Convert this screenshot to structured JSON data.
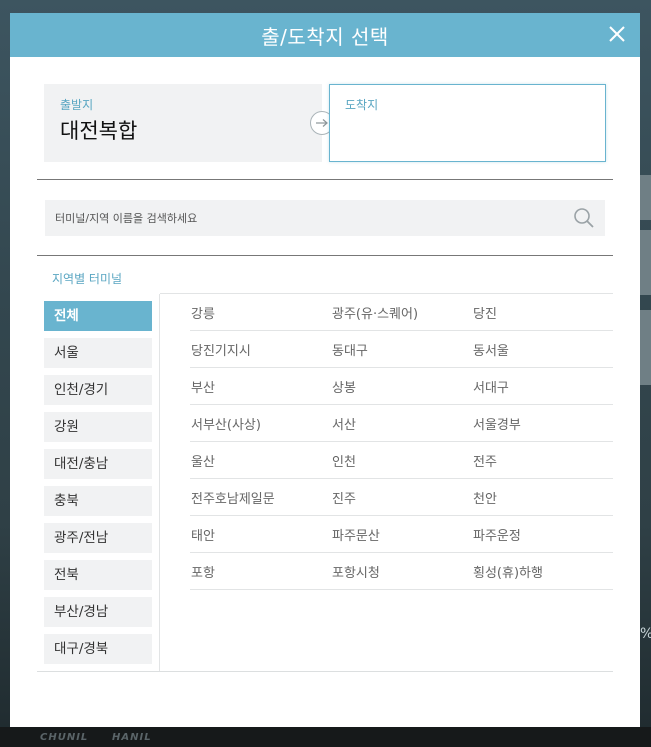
{
  "modal": {
    "title": "출/도착지 선택"
  },
  "route": {
    "departure_label": "출발지",
    "departure_value": "대전복합",
    "arrival_label": "도착지",
    "arrival_value": ""
  },
  "search": {
    "placeholder": "터미널/지역 이름을 검색하세요",
    "value": ""
  },
  "region_section": {
    "title": "지역별 터미널"
  },
  "regions": [
    {
      "label": "전체",
      "active": true
    },
    {
      "label": "서울",
      "active": false
    },
    {
      "label": "인천/경기",
      "active": false
    },
    {
      "label": "강원",
      "active": false
    },
    {
      "label": "대전/충남",
      "active": false
    },
    {
      "label": "충북",
      "active": false
    },
    {
      "label": "광주/전남",
      "active": false
    },
    {
      "label": "전북",
      "active": false
    },
    {
      "label": "부산/경남",
      "active": false
    },
    {
      "label": "대구/경북",
      "active": false
    }
  ],
  "terminals": [
    [
      "강릉",
      "광주(유·스퀘어)",
      "당진"
    ],
    [
      "당진기지시",
      "동대구",
      "동서울"
    ],
    [
      "부산",
      "상봉",
      "서대구"
    ],
    [
      "서부산(사상)",
      "서산",
      "서울경부"
    ],
    [
      "울산",
      "인천",
      "전주"
    ],
    [
      "전주호남제일문",
      "진주",
      "천안"
    ],
    [
      "태안",
      "파주문산",
      "파주운정"
    ],
    [
      "포항",
      "포항시청",
      "횡성(휴)하행"
    ]
  ],
  "background": {
    "footer_logo_1": "CHUNIL",
    "footer_logo_2": "HANIL",
    "edge_text": "%"
  },
  "colors": {
    "accent": "#69b4cf",
    "panel_bg": "#f1f2f3"
  }
}
